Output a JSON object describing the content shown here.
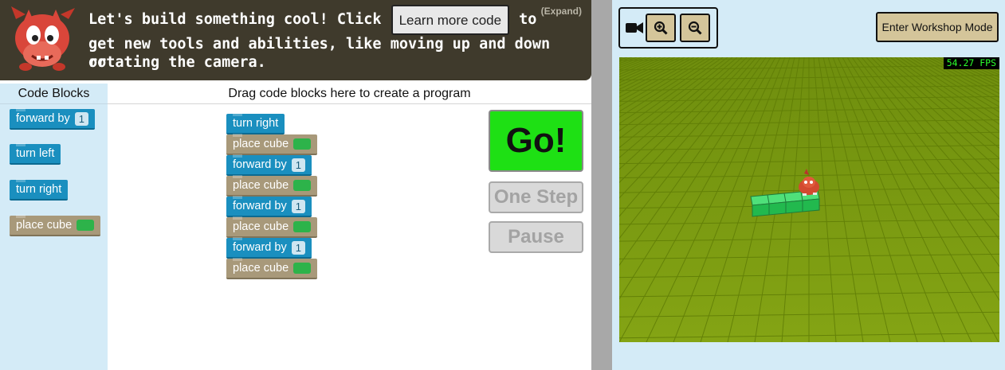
{
  "instructions": {
    "text_before_button": "Let's build something cool! Click",
    "learn_button": "Learn more code",
    "text_after_button": "to",
    "line2": "get new tools and abilities, like moving up and down or",
    "line3": "rotating the camera.",
    "expand": "(Expand)"
  },
  "toolbox": {
    "title": "Code Blocks",
    "blocks": [
      {
        "label": "forward by",
        "value": "1",
        "kind": "move"
      },
      {
        "label": "turn left",
        "kind": "move"
      },
      {
        "label": "turn right",
        "kind": "move"
      },
      {
        "label": "place cube",
        "kind": "place",
        "swatch_color": "#2db34a"
      }
    ]
  },
  "workspace": {
    "header": "Drag code blocks here to create a program",
    "program": [
      {
        "label": "turn right",
        "kind": "move"
      },
      {
        "label": "place cube",
        "kind": "place"
      },
      {
        "label": "forward by",
        "value": "1",
        "kind": "move"
      },
      {
        "label": "place cube",
        "kind": "place"
      },
      {
        "label": "forward by",
        "value": "1",
        "kind": "move"
      },
      {
        "label": "place cube",
        "kind": "place"
      },
      {
        "label": "forward by",
        "value": "1",
        "kind": "move"
      },
      {
        "label": "place cube",
        "kind": "place"
      }
    ],
    "go": "Go!",
    "one_step": "One Step",
    "pause": "Pause"
  },
  "viewer": {
    "camera_icon": "video-camera-icon",
    "zoom_in_icon": "zoom-in-icon",
    "zoom_out_icon": "zoom-out-icon",
    "workshop_button": "Enter Workshop Mode",
    "fps": "54.27 FPS"
  },
  "colors": {
    "move_block": "#1a8fbf",
    "place_block": "#a8997a",
    "go_button": "#1ee014",
    "ground": "#7a9a10",
    "cube": "#2db34a"
  }
}
